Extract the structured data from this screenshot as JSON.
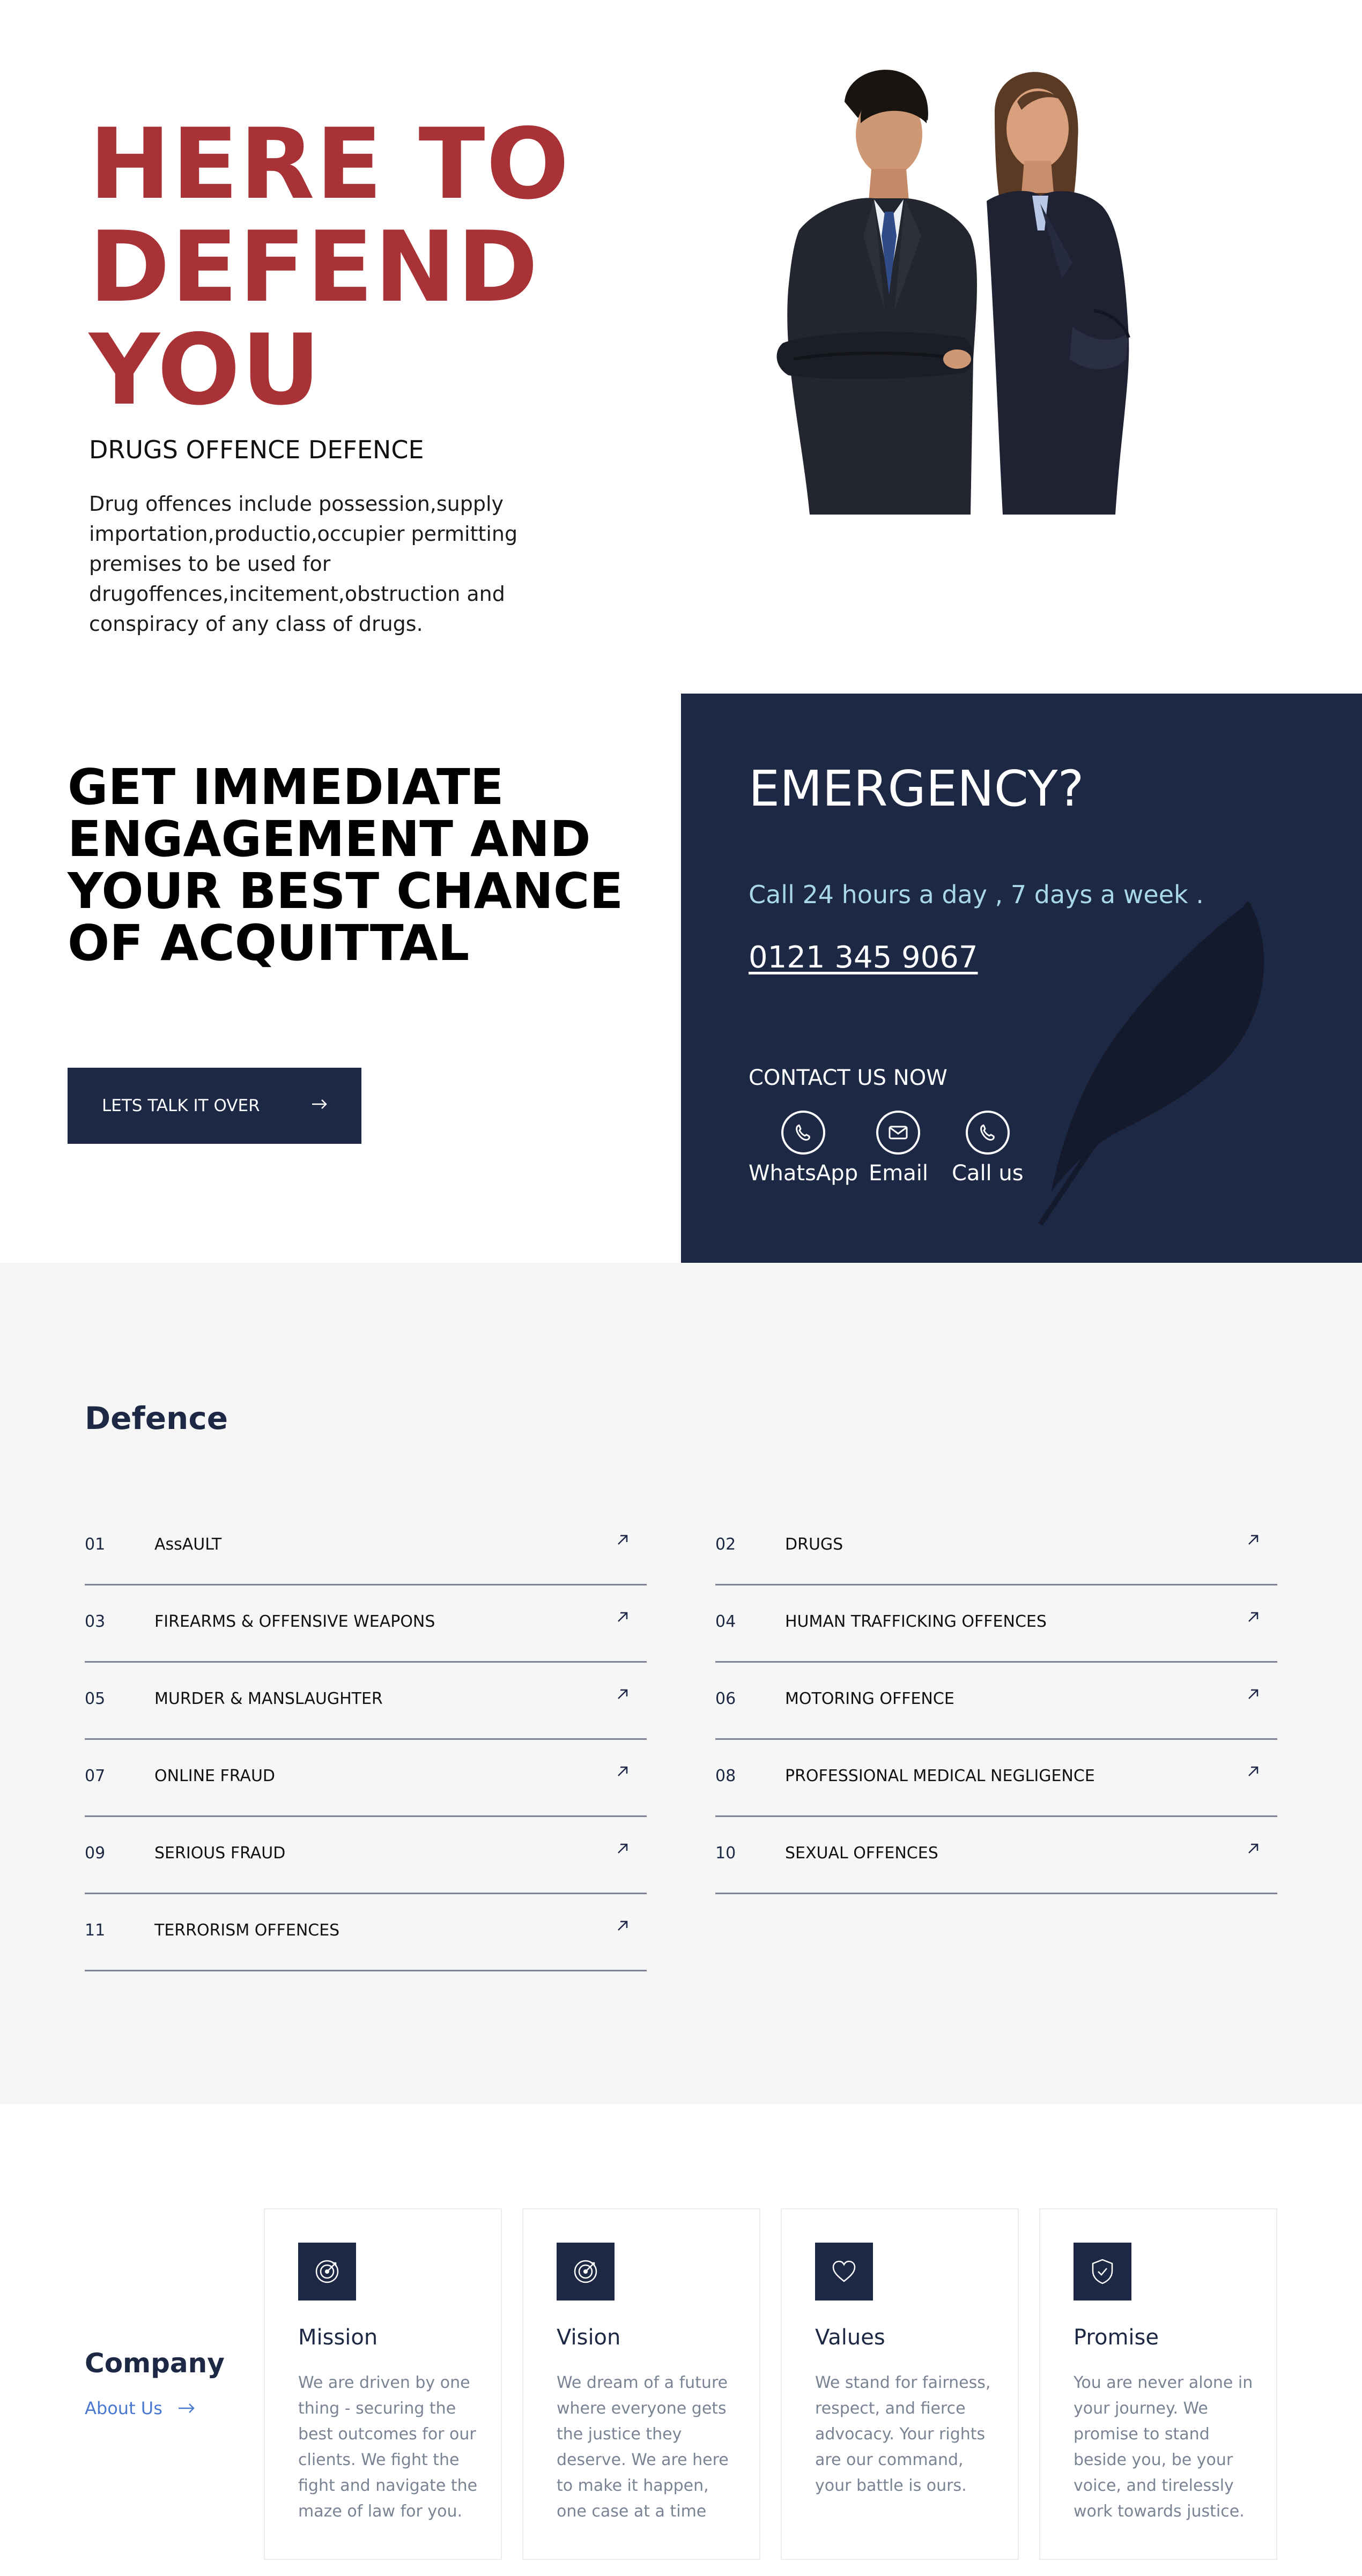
{
  "hero": {
    "title": "HERE TO DEFEND YOU",
    "subtitle": "DRUGS OFFENCE DEFENCE",
    "description": "Drug offences include possession,supply importation,productio,occupier permitting premises to be used for drugoffences,incitement,obstruction and conspiracy of any class of drugs."
  },
  "engagement": {
    "title": "GET IMMEDIATE ENGAGEMENT AND YOUR BEST CHANCE OF ACQUITTAL",
    "button_label": "LETS TALK IT OVER"
  },
  "emergency": {
    "title": "EMERGENCY?",
    "hours": "Call 24 hours a day , 7 days a week .",
    "phone": "0121 345 9067",
    "contact_heading": "CONTACT US NOW",
    "contacts": [
      {
        "label": "WhatsApp",
        "icon": "whatsapp-icon"
      },
      {
        "label": "Email",
        "icon": "email-icon"
      },
      {
        "label": "Call us",
        "icon": "phone-icon"
      }
    ]
  },
  "defence": {
    "title": "Defence",
    "items": [
      {
        "num": "01",
        "label": "AssAULT"
      },
      {
        "num": "02",
        "label": "DRUGS"
      },
      {
        "num": "03",
        "label": "FIREARMS & OFFENSIVE WEAPONS"
      },
      {
        "num": "04",
        "label": "HUMAN TRAFFICKING OFFENCES"
      },
      {
        "num": "05",
        "label": "MURDER & MANSLAUGHTER"
      },
      {
        "num": "06",
        "label": "MOTORING OFFENCE"
      },
      {
        "num": "07",
        "label": "ONLINE FRAUD"
      },
      {
        "num": "08",
        "label": "PROFESSIONAL MEDICAL NEGLIGENCE"
      },
      {
        "num": "09",
        "label": "SERIOUS FRAUD"
      },
      {
        "num": "10",
        "label": "SEXUAL OFFENCES"
      },
      {
        "num": "11",
        "label": "TERRORISM OFFENCES"
      }
    ]
  },
  "company": {
    "title": "Company",
    "link": "About Us",
    "cards": [
      {
        "title": "Mission",
        "icon": "target-icon",
        "text": "We are driven by one thing - securing the best outcomes for our clients. We fight the fight and navigate the maze of law for you."
      },
      {
        "title": "Vision",
        "icon": "target-icon",
        "text": "We dream of a future where everyone gets the justice they deserve. We are here to make it happen, one case at a time"
      },
      {
        "title": "Values",
        "icon": "heart-icon",
        "text": "We stand for fairness, respect, and fierce advocacy. Your rights are our command, your battle is ours."
      },
      {
        "title": "Promise",
        "icon": "shield-check-icon",
        "text": "You are never alone in your journey. We promise to stand beside you, be your voice, and tirelessly work towards justice."
      }
    ]
  },
  "colors": {
    "brand_red": "#a93236",
    "navy": "#1d2845",
    "hours_text": "#a8d8e8",
    "link_blue": "#4a78d0"
  }
}
